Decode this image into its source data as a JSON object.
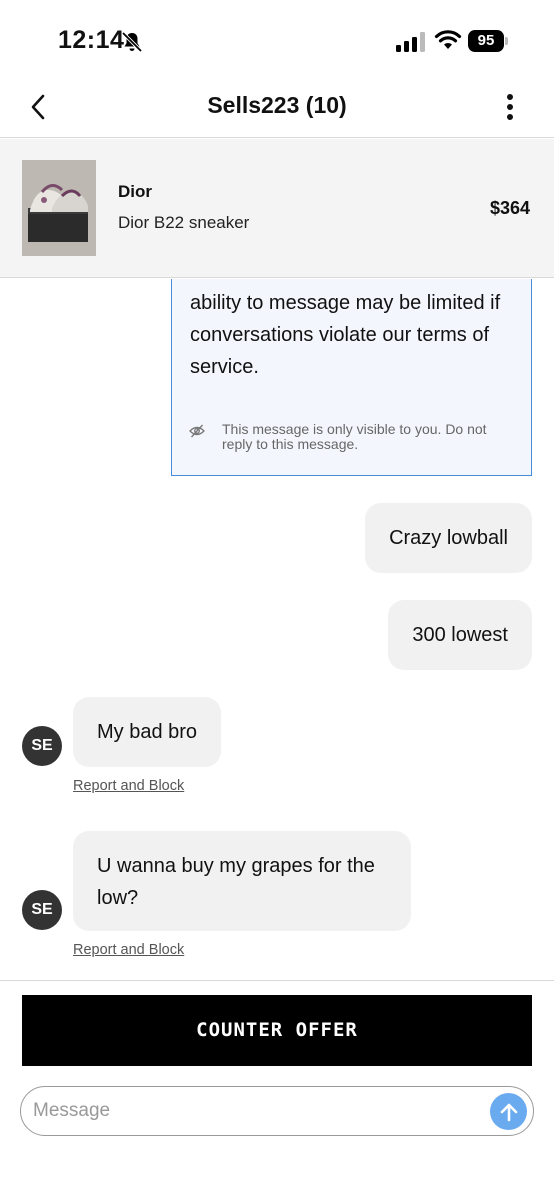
{
  "status_bar": {
    "time": "12:14",
    "battery": "95",
    "icons": [
      "bell-slash-icon",
      "signal-icon",
      "wifi-icon",
      "battery-icon"
    ]
  },
  "header": {
    "title": "Sells223 (10)",
    "icons": [
      "chevron-left-icon",
      "more-vertical-icon"
    ]
  },
  "product": {
    "brand": "Dior",
    "name": "Dior B22 sneaker",
    "price": "$364"
  },
  "system_message": {
    "text": "ability to message may be limited if conversations violate our terms of service.",
    "note": "This message is only visible to you. Do not reply to this message.",
    "accent_color": "#4a8bd6",
    "icon": "eye-off-icon"
  },
  "messages": [
    {
      "direction": "outgoing",
      "text": "Crazy lowball"
    },
    {
      "direction": "outgoing",
      "text": "300 lowest"
    },
    {
      "direction": "incoming",
      "avatar": "SE",
      "text": "My bad bro",
      "report_label": "Report and Block"
    },
    {
      "direction": "incoming",
      "avatar": "SE",
      "text": "U wanna buy my grapes for the low?",
      "report_label": "Report and Block"
    }
  ],
  "actions": {
    "counter_offer_label": "COUNTER OFFER",
    "message_placeholder": "Message",
    "message_value": "",
    "send_color": "#6aabf0"
  }
}
